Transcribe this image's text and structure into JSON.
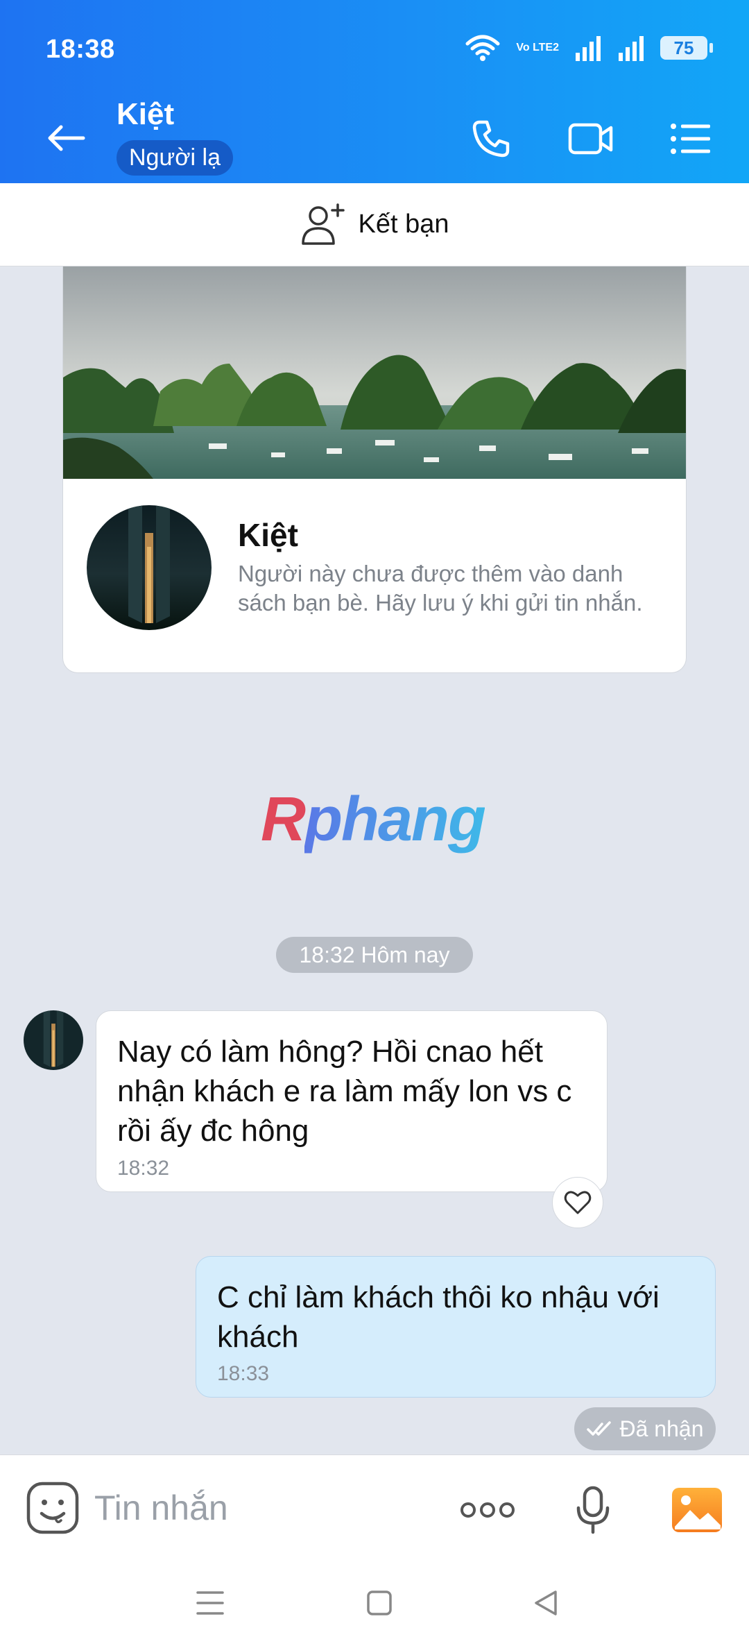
{
  "status_bar": {
    "time": "18:38",
    "battery": "75",
    "network": "Vo LTE2"
  },
  "header": {
    "contact_name": "Kiệt",
    "badge": "Người lạ"
  },
  "add_friend": {
    "label": "Kết bạn"
  },
  "profile_card": {
    "name": "Kiệt",
    "description": "Người này chưa được thêm vào danh sách bạn bè. Hãy lưu ý khi gửi tin nhắn."
  },
  "watermark": {
    "first_letter": "R",
    "rest": "phang"
  },
  "time_separator": "18:32 Hôm nay",
  "messages": [
    {
      "direction": "in",
      "text": "Nay có làm hông? Hồi cnao hết nhận khách e ra làm mấy lon vs c rồi ấy đc hông",
      "time": "18:32"
    },
    {
      "direction": "out",
      "text": "C chỉ làm khách thôi ko nhậu với khách",
      "time": "18:33"
    }
  ],
  "receipt": {
    "label": "Đã nhận"
  },
  "composer": {
    "placeholder": "Tin nhắn"
  },
  "colors": {
    "header_start": "#1e73f2",
    "header_end": "#12a6f7",
    "outgoing_bubble": "#d5edfc",
    "chat_bg": "#e2e6ee"
  },
  "icons": {
    "back": "arrow-left-icon",
    "call": "phone-icon",
    "video": "video-camera-icon",
    "menu": "list-menu-icon",
    "add_friend": "add-user-icon",
    "like": "heart-icon",
    "emoji": "emoji-icon",
    "more": "more-dots-icon",
    "mic": "microphone-icon",
    "image": "image-icon",
    "read": "double-check-icon"
  }
}
